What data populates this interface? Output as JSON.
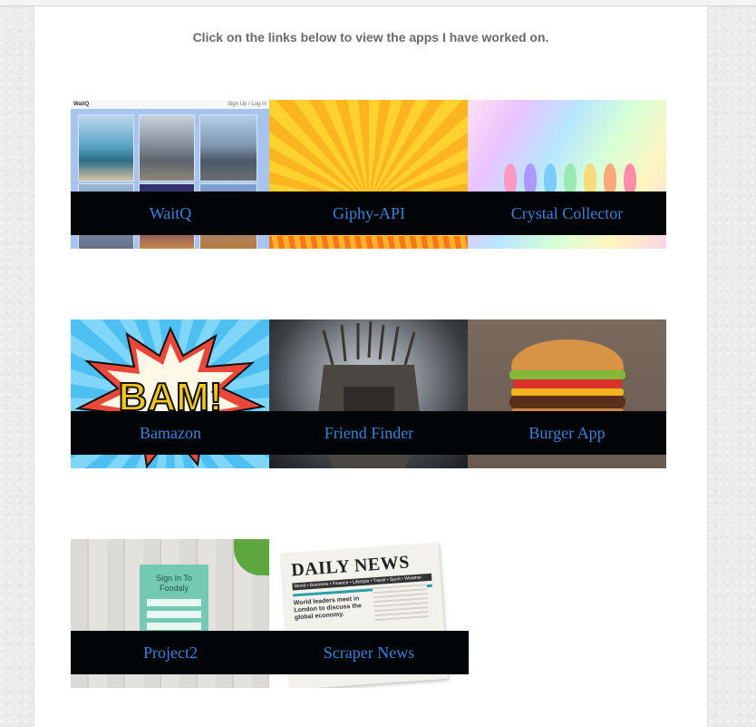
{
  "intro_text": "Click on the links below to view the apps I have worked on.",
  "projects": [
    {
      "title": "WaitQ",
      "thumb_icon": "city-skyline-thumbnail",
      "thumb_header": "WaitQ",
      "thumb_header_right": "Sign Up / Log In"
    },
    {
      "title": "Giphy-API",
      "thumb_icon": "comic-burst-thumbnail"
    },
    {
      "title": "Crystal Collector",
      "thumb_icon": "crystals-thumbnail"
    },
    {
      "title": "Bamazon",
      "thumb_icon": "bam-comic-thumbnail",
      "thumb_text": "BAM!"
    },
    {
      "title": "Friend Finder",
      "thumb_icon": "iron-throne-thumbnail"
    },
    {
      "title": "Burger App",
      "thumb_icon": "burger-thumbnail"
    },
    {
      "title": "Project2",
      "thumb_icon": "foodaly-signin-thumbnail",
      "thumb_text": "Sign In To Foodaly"
    },
    {
      "title": "Scraper News",
      "thumb_icon": "newspaper-thumbnail",
      "thumb_text": "DAILY NEWS",
      "thumb_sections": "World • Business • Finance • Lifestyle • Travel • Sport • Weather",
      "thumb_headline": "World leaders meet in London to discuss the global economy."
    }
  ],
  "colors": {
    "link": "#3a82d6",
    "bar": "#020507",
    "intro": "#6a6a6a"
  }
}
